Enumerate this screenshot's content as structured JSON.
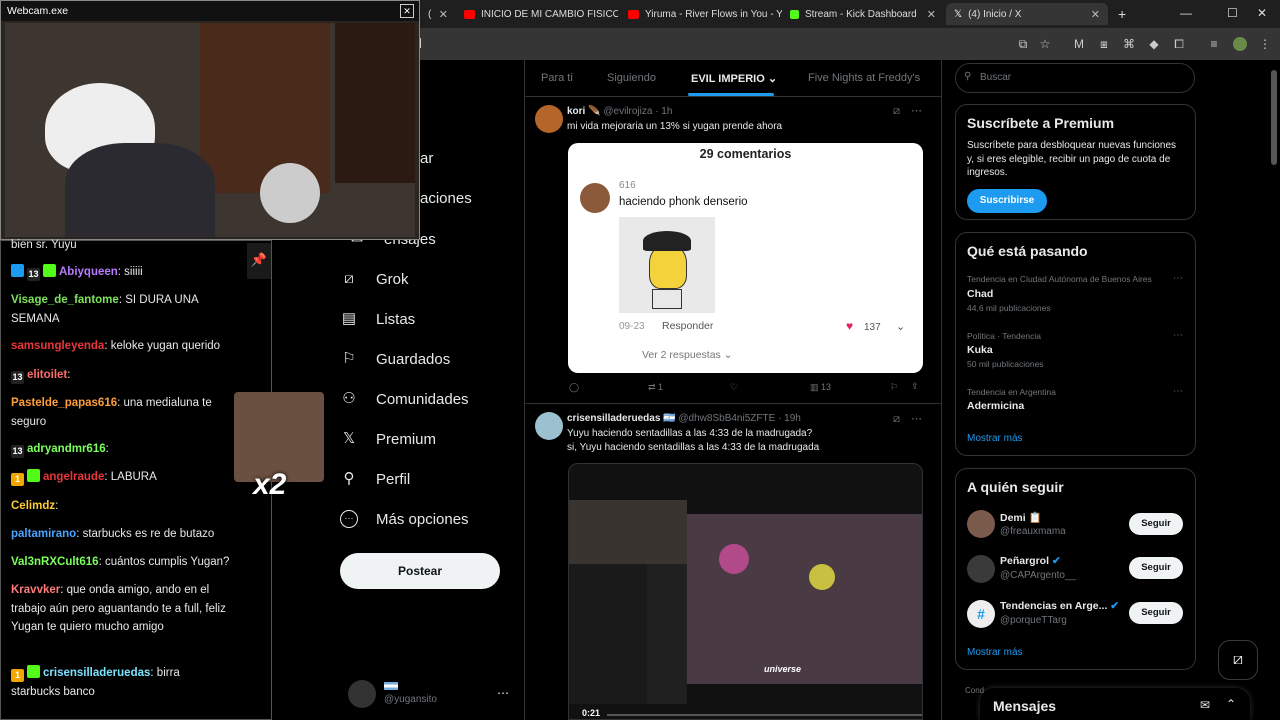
{
  "browser": {
    "tabs": [
      {
        "label": "(",
        "active": false,
        "color": "#888888"
      },
      {
        "label": "INICIO DE MI CAMBIO FISICO 💪",
        "active": false,
        "color": "#ff0000"
      },
      {
        "label": "Yiruma - River Flows in You - Yo",
        "active": false,
        "color": "#ff0000"
      },
      {
        "label": "Stream - Kick Dashboard",
        "active": false,
        "color": "#53fc18"
      },
      {
        "label": "(4) Inicio / X",
        "active": true,
        "color": "#ffffff"
      }
    ],
    "new_tab": "+",
    "win_min": "—",
    "win_max": "☐",
    "win_close": "✕"
  },
  "webcam": {
    "title": "Webcam.exe",
    "close": "✕"
  },
  "chat": {
    "lines": [
      {
        "user": "",
        "ucolor": "#e7e9ea",
        "text": "bien sr. Yuyu",
        "badges": []
      },
      {
        "user": "Abiyqueen",
        "ucolor": "#b97cff",
        "text": ": siiiii",
        "badges": [
          "#1d9bf0",
          "13",
          "#53fc18"
        ]
      },
      {
        "user": "Visage_de_fantome",
        "ucolor": "#7ce35b",
        "text": ": SI DURA UNA",
        "badges": []
      },
      {
        "user": "",
        "ucolor": "#e7e9ea",
        "text": "SEMANA",
        "badges": []
      },
      {
        "user": "samsungleyenda",
        "ucolor": "#e8363b",
        "text": ": keloke yugan querido",
        "badges": []
      },
      {
        "user": "elitoilet",
        "ucolor": "#ff6b6b",
        "text": ":",
        "badges": [
          "13"
        ]
      },
      {
        "user": "Pastelde_papas616",
        "ucolor": "#ff9e3d",
        "text": ": una medialuna te",
        "badges": []
      },
      {
        "user": "",
        "ucolor": "#e7e9ea",
        "text": "seguro",
        "badges": []
      },
      {
        "user": "adryandmr616",
        "ucolor": "#7cff5b",
        "text": ":",
        "badges": [
          "13"
        ]
      },
      {
        "user": "angelraude",
        "ucolor": "#e8363b",
        "text": ": LABURA",
        "badges": [
          "1",
          "#53fc18"
        ]
      },
      {
        "user": "Celimdz",
        "ucolor": "#ffcc33",
        "text": ":",
        "badges": []
      },
      {
        "user": "paltamirano",
        "ucolor": "#4aa3ff",
        "text": ": starbucks es re de butazo",
        "badges": []
      },
      {
        "user": "Val3nRXCult616",
        "ucolor": "#7cff5b",
        "text": ": cuántos cumplis Yugan?",
        "badges": []
      },
      {
        "user": "Kravvker",
        "ucolor": "#ff7a7a",
        "text": ": que onda amigo, ando en el",
        "badges": []
      },
      {
        "user": "",
        "ucolor": "#e7e9ea",
        "text": "trabajo aún pero aguantando te a full, feliz",
        "badges": []
      },
      {
        "user": "",
        "ucolor": "#e7e9ea",
        "text": "Yugan te quiero mucho amigo",
        "badges": []
      },
      {
        "user": "crisensilladeruedas",
        "ucolor": "#7ce3ff",
        "text": ": birra",
        "badges": [
          "1",
          "#53fc18"
        ]
      },
      {
        "user": "",
        "ucolor": "#e7e9ea",
        "text": "starbucks banco",
        "badges": []
      }
    ],
    "x2": "x2"
  },
  "nav": {
    "items": [
      {
        "label": "ar",
        "icon": ""
      },
      {
        "label": "aciones",
        "icon": ""
      },
      {
        "label": "ensajes",
        "icon": ""
      },
      {
        "label": "Grok",
        "icon": "⧄"
      },
      {
        "label": "Listas",
        "icon": "▤"
      },
      {
        "label": "Guardados",
        "icon": "🔖"
      },
      {
        "label": "Comunidades",
        "icon": "👥"
      },
      {
        "label": "Premium",
        "icon": "𝕏"
      },
      {
        "label": "Perfil",
        "icon": "👤"
      },
      {
        "label": "Más opciones",
        "icon": "⋯"
      }
    ],
    "post_label": "Postear",
    "account_handle": "@yugansito"
  },
  "feed": {
    "tabs": [
      "Para ti",
      "Siguiendo",
      "EVIL IMPERIO",
      "Five Nights at Freddy's"
    ],
    "post1": {
      "name": "kori 🪶",
      "handle": "@evilrojiza",
      "time": "· 1h",
      "text": "mi vida mejoraria un 13% si yugan prende ahora",
      "embed": {
        "title": "29 comentarios",
        "comment_user": "616",
        "comment_text": "haciendo phonk denserio",
        "date": "09-23",
        "reply": "Responder",
        "likes": "137",
        "more_replies": "Ver 2 respuestas ⌄"
      },
      "retweets": "1",
      "views": "13"
    },
    "post2": {
      "name": "crisensilladeruedas 🇦🇷",
      "handle": "@dhw8SbB4ni5ZFTE",
      "time": "· 19h",
      "text1": "Yuyu haciendo sentadillas a las 4:33 de la madrugada?",
      "text2": "si, Yuyu haciendo sentadillas a las 4:33 de la madrugada",
      "video_time": "0:21",
      "video_caption": "universe"
    }
  },
  "right": {
    "search_placeholder": "Buscar",
    "premium": {
      "title": "Suscríbete a Premium",
      "body": "Suscríbete para desbloquear nuevas funciones y, si eres elegible, recibir un pago de cuota de ingresos.",
      "button": "Suscribirse"
    },
    "trends": {
      "title": "Qué está pasando",
      "items": [
        {
          "meta": "Tendencia en Ciudad Autónoma de Buenos Aires",
          "name": "Chad",
          "count": "44,6 mil publicaciones"
        },
        {
          "meta": "Política · Tendencia",
          "name": "Kuka",
          "count": "50 mil publicaciones"
        },
        {
          "meta": "Tendencia en Argentina",
          "name": "Adermicina",
          "count": ""
        }
      ],
      "more": "Mostrar más"
    },
    "follow": {
      "title": "A quién seguir",
      "items": [
        {
          "name": "Demi 📋",
          "handle": "@freauxmama",
          "button": "Seguir"
        },
        {
          "name": "Peñargrol",
          "handle": "@CAPArgento__",
          "button": "Seguir"
        },
        {
          "name": "Tendencias en Arge...",
          "handle": "@porqueTTarg",
          "button": "Seguir"
        }
      ],
      "more": "Mostrar más"
    },
    "footer_partial": "Cond",
    "messages": "Mensajes"
  }
}
